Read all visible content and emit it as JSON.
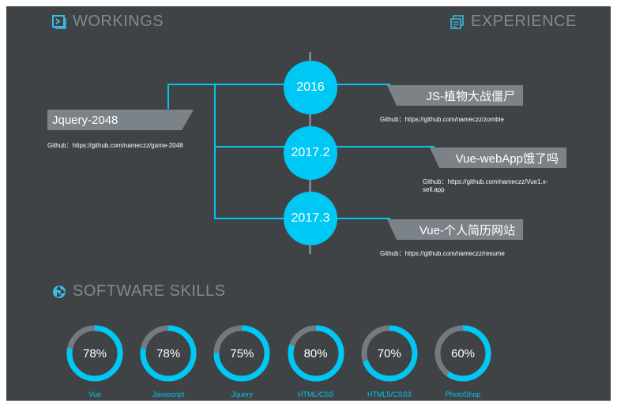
{
  "sections": {
    "workings": "WORKINGS",
    "experience": "EXPERIENCE",
    "skills": "SOFTWARE SKILLS"
  },
  "timeline": {
    "years": [
      "2016",
      "2017.2",
      "2017.3"
    ],
    "left_project": {
      "title": "Jquery-2048",
      "github": "Github：https://github.com/nameczz/game-2048"
    },
    "right_projects": [
      {
        "title": "JS-植物大战僵尸",
        "github": "Github：https://github.com/nameczz/zombie"
      },
      {
        "title": "Vue-webApp饿了吗",
        "github": "Github：https://github.com/nameczz/Vue1.x-sell.app"
      },
      {
        "title": "Vue-个人简历网站",
        "github": "Github：https://github.com/nameczz/resume"
      }
    ]
  },
  "skills": [
    {
      "name": "Vue",
      "percent": 78,
      "label": "78%"
    },
    {
      "name": "Javascript",
      "percent": 78,
      "label": "78%"
    },
    {
      "name": "Jquery",
      "percent": 75,
      "label": "75%"
    },
    {
      "name": "HTML/CSS",
      "percent": 80,
      "label": "80%"
    },
    {
      "name": "HTML5/CSS3",
      "percent": 70,
      "label": "70%"
    },
    {
      "name": "PhotoShop",
      "percent": 60,
      "label": "60%"
    }
  ],
  "colors": {
    "background": "#3f4346",
    "accent": "#00c8f4",
    "ring_track": "#737b81",
    "tag": "#7c8388",
    "heading": "#7f8a92"
  },
  "icons": {
    "workings": "code-box-icon",
    "experience": "document-stack-icon",
    "skills": "aperture-icon"
  }
}
